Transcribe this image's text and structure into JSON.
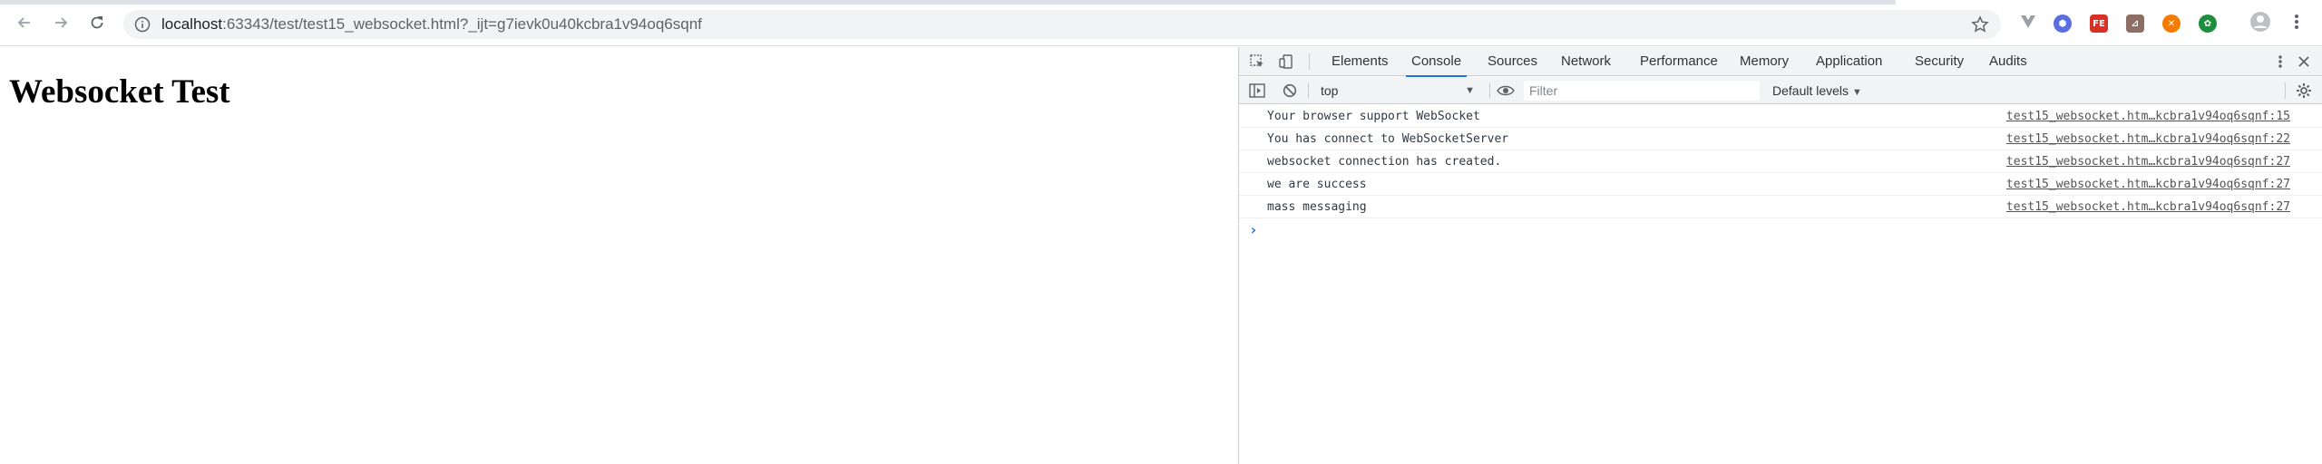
{
  "browser": {
    "url_host": "localhost",
    "url_rest": ":63343/test/test15_websocket.html?_ijt=g7ievk0u40kcbra1v94oq6sqnf",
    "icons": {
      "back": "arrow-left-icon",
      "forward": "arrow-right-icon",
      "reload": "reload-icon",
      "info": "info-icon",
      "bookmark": "star-icon",
      "profile": "avatar-icon",
      "menu": "kebab-menu-icon"
    },
    "extensions": [
      {
        "name": "vue-devtools-extension",
        "label": "V",
        "color": "#9aa0a6"
      },
      {
        "name": "shield-extension",
        "label": "⬢",
        "color": "#5b6ee1"
      },
      {
        "name": "fe-helper-extension",
        "label": "FE",
        "color": "#d93025"
      },
      {
        "name": "pdf-extension",
        "label": "⊿",
        "color": "#8d6e63"
      },
      {
        "name": "orange-extension",
        "label": "✕",
        "color": "#f57c00"
      },
      {
        "name": "evernote-extension",
        "label": "✿",
        "color": "#1e8e3e"
      }
    ]
  },
  "page": {
    "heading": "Websocket Test"
  },
  "devtools": {
    "tabs": [
      "Elements",
      "Console",
      "Sources",
      "Network",
      "Performance",
      "Memory",
      "Application",
      "Security",
      "Audits"
    ],
    "active_tab": "Console",
    "context": "top",
    "filter_placeholder": "Filter",
    "levels_label": "Default levels",
    "messages": [
      {
        "text": "Your browser support WebSocket",
        "source": "test15_websocket.htm…kcbra1v94oq6sqnf:15"
      },
      {
        "text": "You has connect to WebSocketServer",
        "source": "test15_websocket.htm…kcbra1v94oq6sqnf:22"
      },
      {
        "text": "websocket connection has created.",
        "source": "test15_websocket.htm…kcbra1v94oq6sqnf:27"
      },
      {
        "text": "we are success",
        "source": "test15_websocket.htm…kcbra1v94oq6sqnf:27"
      },
      {
        "text": "mass messaging",
        "source": "test15_websocket.htm…kcbra1v94oq6sqnf:27"
      }
    ],
    "prompt_symbol": "›"
  }
}
